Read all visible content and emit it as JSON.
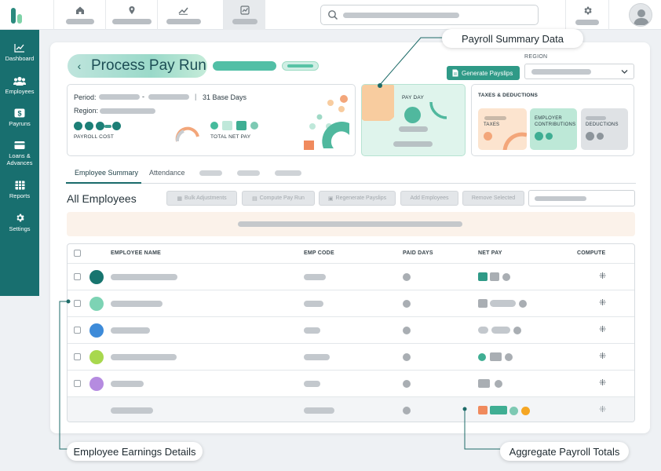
{
  "colors": {
    "sidebar": "#186f6f",
    "accent_green": "#2f9a87",
    "title_pill": "#a6dccd",
    "banner": "#fbf2ea",
    "peach": "#f8cc9f",
    "mint": "#dff4ec",
    "teal": "#50b89e",
    "orange": "#f08a5d"
  },
  "topnav": [
    {
      "icon": "home-icon"
    },
    {
      "icon": "location-icon"
    },
    {
      "icon": "trending-icon"
    },
    {
      "icon": "chart-icon",
      "active": true
    },
    {
      "icon": "gear-icon"
    }
  ],
  "sidebar": {
    "items": [
      {
        "label": "Dashboard",
        "icon": "chart-line-icon"
      },
      {
        "label": "Employees",
        "icon": "users-icon"
      },
      {
        "label": "Payruns",
        "icon": "dollar-icon"
      },
      {
        "label": "Loans &",
        "label2": "Advances",
        "icon": "card-icon"
      },
      {
        "label": "Reports",
        "icon": "table-icon"
      },
      {
        "label": "Settings",
        "icon": "gear-icon"
      }
    ]
  },
  "header": {
    "title": "Process Pay Run",
    "generate_button": "Generate Payslips",
    "region_label": "REGION"
  },
  "summary": {
    "period_label": "Period:",
    "base_days": "31 Base Days",
    "region_label": "Region:",
    "payroll_cost_label": "PAYROLL COST",
    "total_net_pay_label": "TOTAL NET PAY",
    "pay_day_label": "PAY DAY",
    "taxes_deductions_title": "TAXES & DEDUCTIONS",
    "taxes_label": "TAXES",
    "employer_contrib_label": "EMPLOYER",
    "employer_contrib_label2": "CONTRIBUTIONS",
    "deductions_label": "DEDUCTIONS"
  },
  "tabs": [
    {
      "label": "Employee Summary",
      "active": true
    },
    {
      "label": "Attendance"
    }
  ],
  "section_title": "All Employees",
  "toolbar": {
    "bulk": "Bulk Adjustments",
    "compute": "Compute Pay Run",
    "regenerate": "Regenerate Payslips",
    "add": "Add Employees",
    "remove": "Remove Selected"
  },
  "table": {
    "headers": [
      "EMPLOYEE NAME",
      "EMP CODE",
      "PAID DAYS",
      "NET PAY",
      "COMPUTE"
    ],
    "rows": [
      {
        "avatar_color": "#18756f"
      },
      {
        "avatar_color": "#7dd3b4"
      },
      {
        "avatar_color": "#3d8bd9"
      },
      {
        "avatar_color": "#a8d84e"
      },
      {
        "avatar_color": "#b58be0"
      }
    ]
  },
  "callouts": {
    "payroll_summary": "Payroll Summary Data",
    "employee_earnings": "Employee Earnings Details",
    "aggregate_totals": "Aggregate Payroll Totals"
  }
}
